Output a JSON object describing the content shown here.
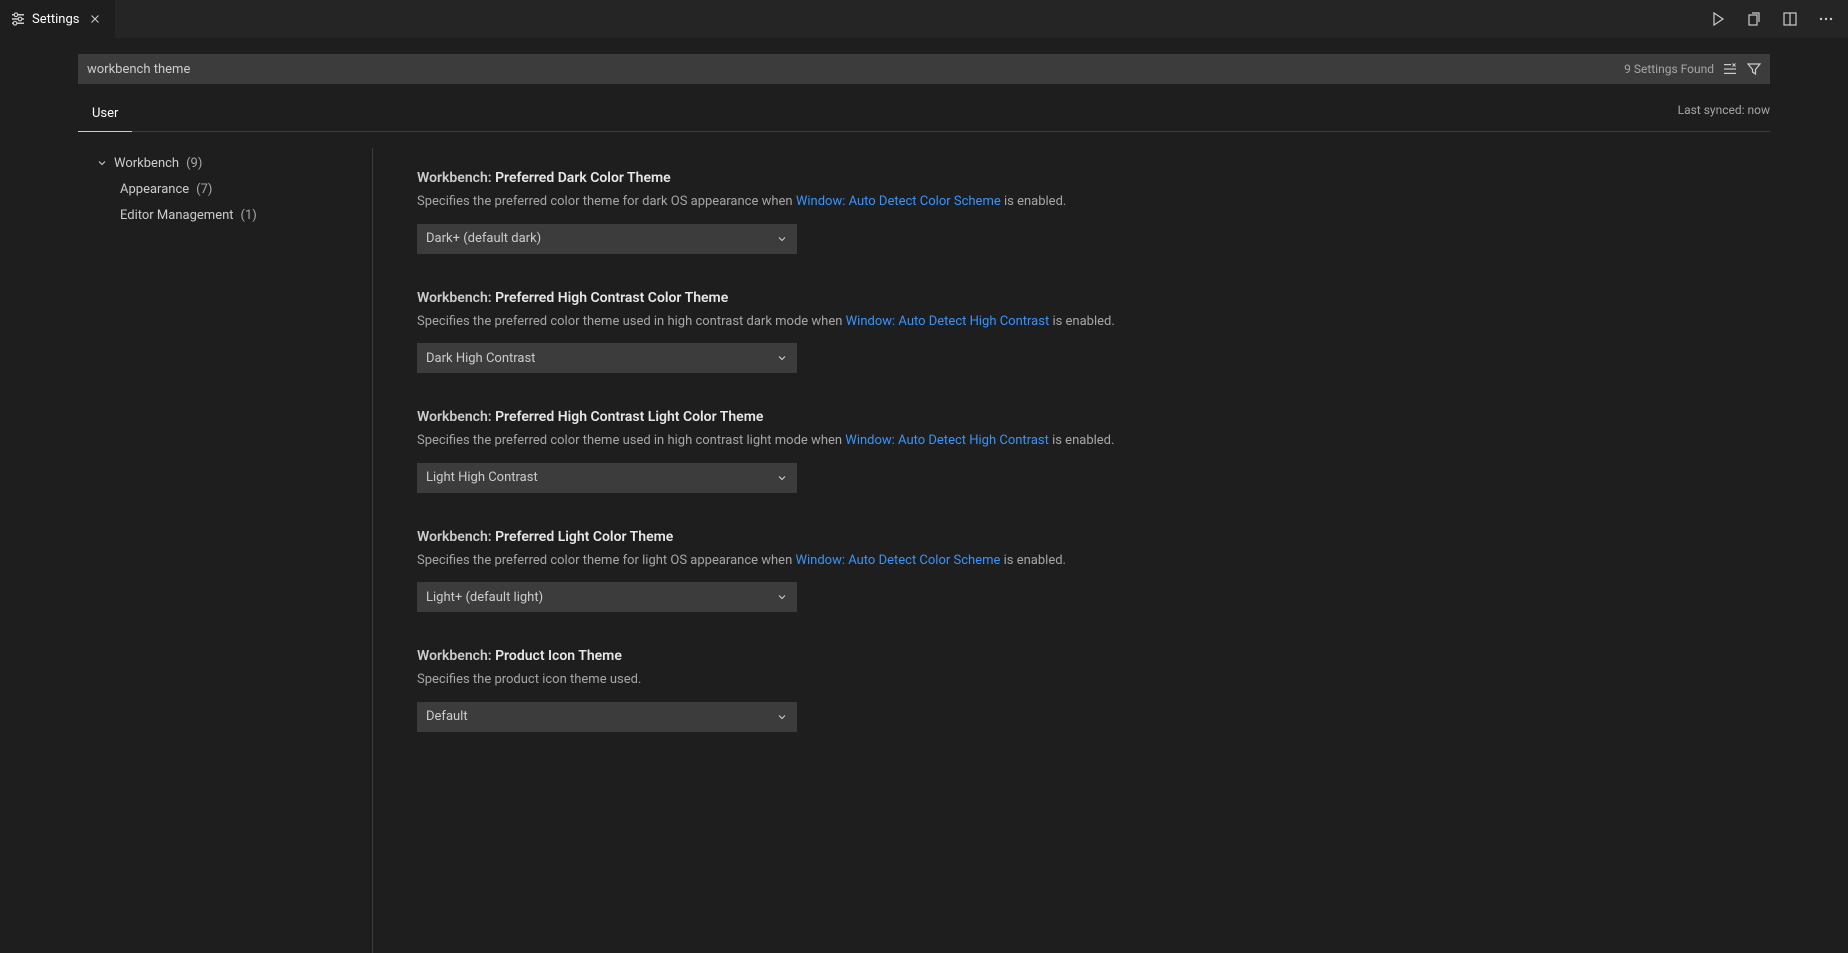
{
  "tab": {
    "label": "Settings"
  },
  "search": {
    "value": "workbench theme",
    "placeholder": "Search settings",
    "found_count": "9 Settings Found"
  },
  "scope": {
    "user": "User"
  },
  "sync_status": "Last synced: now",
  "toc": {
    "workbench_label": "Workbench",
    "workbench_count": "(9)",
    "appearance_label": "Appearance",
    "appearance_count": "(7)",
    "editor_mgmt_label": "Editor Management",
    "editor_mgmt_count": "(1)"
  },
  "settings": [
    {
      "category": "Workbench: ",
      "name": "Preferred Dark Color Theme",
      "desc_pre": "Specifies the preferred color theme for dark OS appearance when ",
      "link": "Window: Auto Detect Color Scheme",
      "desc_post": " is enabled.",
      "value": "Dark+ (default dark)"
    },
    {
      "category": "Workbench: ",
      "name": "Preferred High Contrast Color Theme",
      "desc_pre": "Specifies the preferred color theme used in high contrast dark mode when ",
      "link": "Window: Auto Detect High Contrast",
      "desc_post": " is enabled.",
      "value": "Dark High Contrast"
    },
    {
      "category": "Workbench: ",
      "name": "Preferred High Contrast Light Color Theme",
      "desc_pre": "Specifies the preferred color theme used in high contrast light mode when ",
      "link": "Window: Auto Detect High Contrast",
      "desc_post": " is enabled.",
      "value": "Light High Contrast"
    },
    {
      "category": "Workbench: ",
      "name": "Preferred Light Color Theme",
      "desc_pre": "Specifies the preferred color theme for light OS appearance when ",
      "link": "Window: Auto Detect Color Scheme",
      "desc_post": " is enabled.",
      "value": "Light+ (default light)"
    },
    {
      "category": "Workbench: ",
      "name": "Product Icon Theme",
      "desc_pre": "Specifies the product icon theme used.",
      "link": "",
      "desc_post": "",
      "value": "Default"
    }
  ]
}
